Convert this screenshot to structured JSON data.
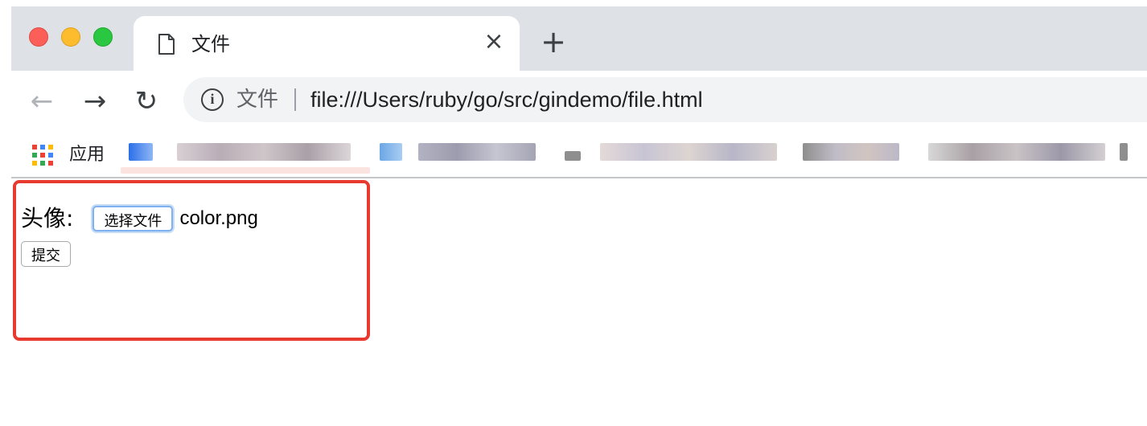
{
  "browser": {
    "tab": {
      "title": "文件",
      "icon": "document-icon",
      "close": "×"
    },
    "new_tab": "+",
    "nav": {
      "back": "←",
      "forward": "→",
      "reload": "↻"
    },
    "omnibox": {
      "info": "i",
      "scheme_label": "文件",
      "url": "file:///Users/ruby/go/src/gindemo/file.html"
    },
    "bookmarks": {
      "apps_label": "应用"
    }
  },
  "form": {
    "avatar_label": "头像:",
    "file_button_label": "选择文件",
    "file_name": "color.png",
    "submit_label": "提交"
  },
  "colors": {
    "highlight": "#e83a2f",
    "tabstrip": "#dee1e6",
    "omnibox": "#f1f3f4"
  }
}
